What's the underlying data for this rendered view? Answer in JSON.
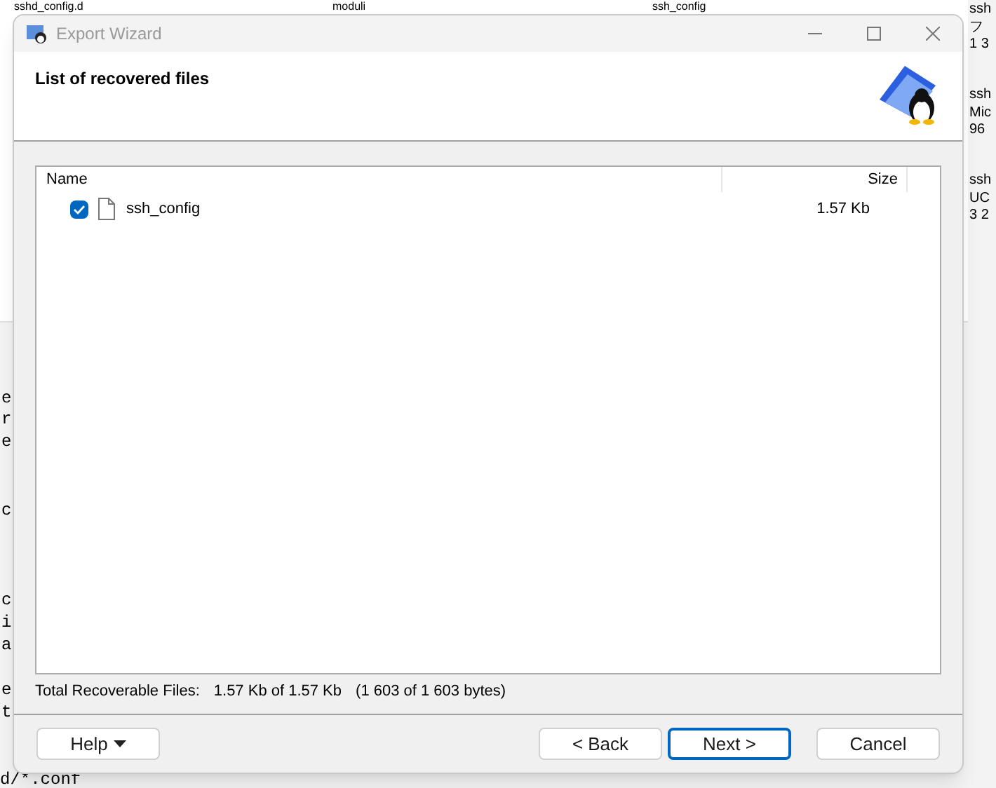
{
  "background": {
    "top_items": [
      "sshd_config.d",
      "moduli",
      "ssh_config"
    ],
    "right_items": [
      [
        "ssh",
        "フ",
        "1 3"
      ],
      [
        "ssh",
        "Mic",
        "96"
      ],
      [
        "ssh",
        "UC",
        "3 2"
      ]
    ],
    "left_lines": [
      "e",
      "r",
      "e",
      "c",
      "c",
      "i",
      "a",
      "e",
      "t"
    ],
    "bottom_line": "d/*.conf"
  },
  "window": {
    "title": "Export Wizard",
    "heading": "List of recovered files"
  },
  "table": {
    "columns": [
      "Name",
      "Size"
    ],
    "rows": [
      {
        "name": "ssh_config",
        "size": "1.57 Kb",
        "checked": true
      }
    ]
  },
  "summary": {
    "label": "Total Recoverable Files:",
    "value": "1.57 Kb of 1.57 Kb",
    "bytes": "(1 603 of 1 603 bytes)"
  },
  "buttons": [
    {
      "label": "Help",
      "kind": "menu",
      "default": false
    },
    {
      "label": "< Back",
      "kind": "plain",
      "default": false
    },
    {
      "label": "Next >",
      "kind": "plain",
      "default": true
    },
    {
      "label": "Cancel",
      "kind": "plain",
      "default": false
    }
  ]
}
